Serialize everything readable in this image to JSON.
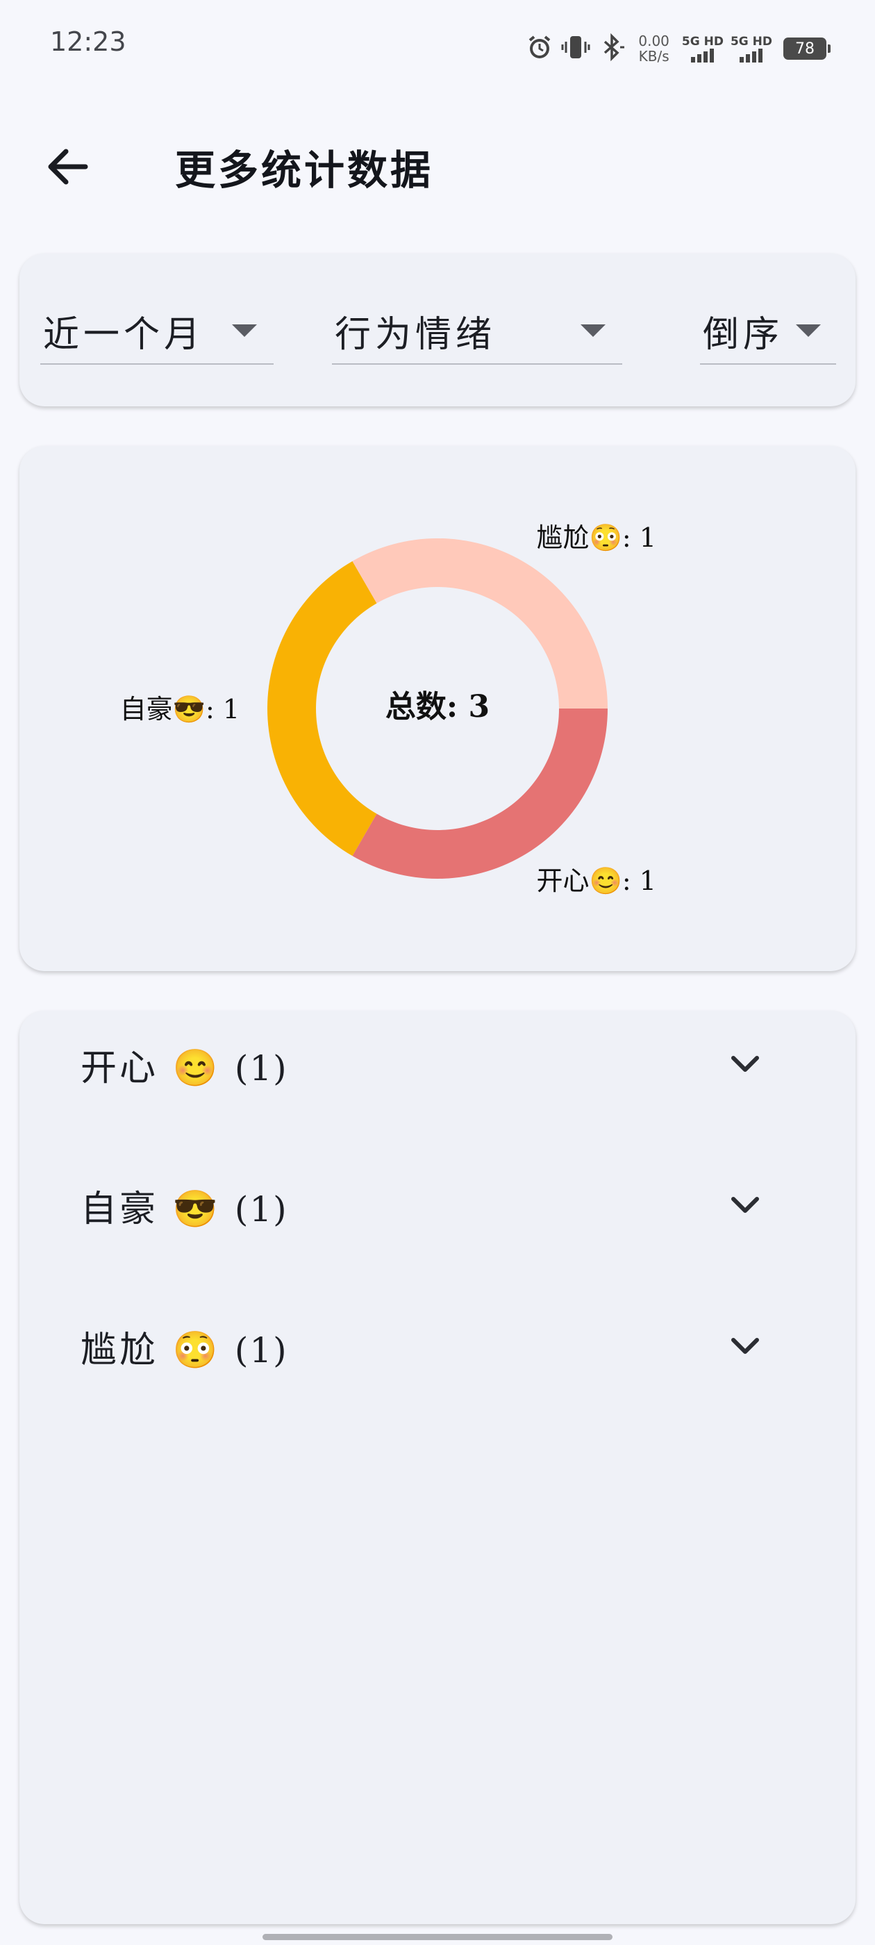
{
  "status_bar": {
    "time": "12:23",
    "net_speed_value": "0.00",
    "net_speed_unit": "KB/s",
    "sim1_label": "5G HD",
    "sim2_label": "5G HD",
    "battery": "78",
    "icons": [
      "alarm-icon",
      "vibrate-icon",
      "bluetooth-icon",
      "signal-icon",
      "battery-icon"
    ]
  },
  "header": {
    "title": "更多统计数据",
    "back_icon": "arrow-left-icon"
  },
  "filters": {
    "range": "近一个月",
    "category": "行为情绪",
    "order": "倒序"
  },
  "chart_data": {
    "type": "pie",
    "style": "donut",
    "center_label": "总数: 3",
    "slices": [
      {
        "name": "开心😊",
        "value": 1,
        "label": "开心😊: 1",
        "color": "#e57373"
      },
      {
        "name": "自豪😎",
        "value": 1,
        "label": "自豪😎: 1",
        "color": "#f9b204"
      },
      {
        "name": "尴尬😳",
        "value": 1,
        "label": "尴尬😳: 1",
        "color": "#ffc9ba"
      }
    ],
    "legend": "none"
  },
  "list": {
    "items": [
      {
        "label": "开心 😊",
        "count": "(1)"
      },
      {
        "label": "自豪 😎",
        "count": "(1)"
      },
      {
        "label": "尴尬 😳",
        "count": "(1)"
      }
    ]
  },
  "colors": {
    "background": "#f6f7fc",
    "card": "#eff1f7",
    "happy": "#e57373",
    "proud": "#f9b204",
    "awkward": "#ffc9ba"
  }
}
